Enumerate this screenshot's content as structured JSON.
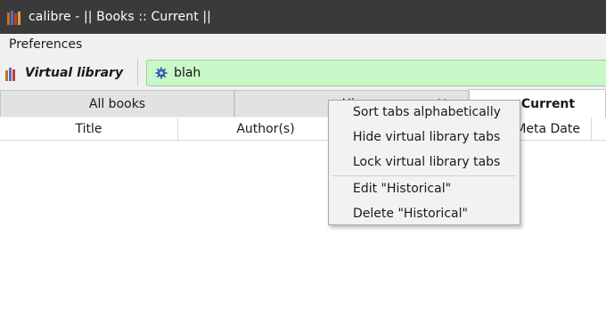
{
  "window": {
    "title": "calibre - || Books :: Current ||",
    "app_icon": "calibre-books-icon"
  },
  "menubar": {
    "items": [
      {
        "label": "Preferences"
      }
    ]
  },
  "toolbar": {
    "virtual_library_label": "Virtual library",
    "search": {
      "value": "blah",
      "background_color": "#c9f7c7",
      "icon": "gear-icon"
    }
  },
  "tabs": [
    {
      "label": "All books",
      "active": false
    },
    {
      "label": "Historical",
      "visible_label": "His",
      "active": false
    },
    {
      "label": "Current",
      "active": true
    }
  ],
  "columns": [
    {
      "label": "Title"
    },
    {
      "label": "Author(s)"
    },
    {
      "label": "Meta Date"
    }
  ],
  "context_menu": {
    "items": [
      {
        "label": "Sort tabs alphabetically"
      },
      {
        "label": "Hide virtual library tabs"
      },
      {
        "label": "Lock virtual library tabs"
      },
      {
        "label": "Edit \"Historical\""
      },
      {
        "label": "Delete \"Historical\""
      }
    ]
  },
  "colors": {
    "titlebar": "#3a3a3a",
    "chrome": "#f0f0f0",
    "search_bg": "#c9f7c7"
  }
}
